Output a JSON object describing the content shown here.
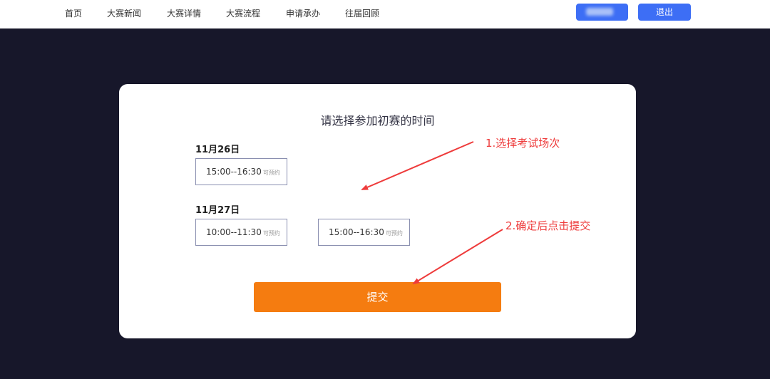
{
  "nav": {
    "items": [
      {
        "label": "首页"
      },
      {
        "label": "大赛新闻"
      },
      {
        "label": "大赛详情"
      },
      {
        "label": "大赛流程"
      },
      {
        "label": "申请承办"
      },
      {
        "label": "往届回顾"
      }
    ],
    "logout_label": "退出"
  },
  "card": {
    "title": "请选择参加初赛的时间",
    "dates": [
      {
        "label": "11月26日",
        "slots": [
          {
            "time": "15:00--16:30",
            "status": "可预约"
          }
        ]
      },
      {
        "label": "11月27日",
        "slots": [
          {
            "time": "10:00--11:30",
            "status": "可预约"
          },
          {
            "time": "15:00--16:30",
            "status": "可预约"
          }
        ]
      }
    ],
    "submit_label": "提交"
  },
  "annotations": {
    "step1": "1.选择考试场次",
    "step2": "2.确定后点击提交"
  },
  "colors": {
    "primary_button": "#3d6ef5",
    "submit_button": "#f57c10",
    "annotation": "#ee3b3b",
    "page_background": "#17172a"
  }
}
